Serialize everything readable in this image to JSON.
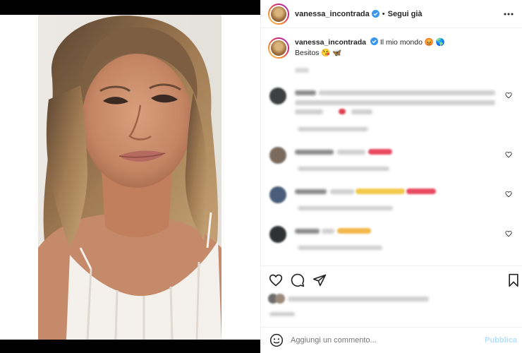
{
  "header": {
    "username": "vanessa_incontrada",
    "separator": "•",
    "follow_label": "Segui già"
  },
  "caption": {
    "username": "vanessa_incontrada",
    "text_line1": "Il mio mondo 😡 🌎",
    "text_line2": "Besitos 😘 🦋"
  },
  "comment_box": {
    "placeholder": "Aggiungi un commento...",
    "publish_label": "Pubblica"
  },
  "icons": {
    "more": "more-options-icon",
    "verified": "verified-badge-icon",
    "like": "heart-icon",
    "comment": "comment-bubble-icon",
    "share": "paper-plane-icon",
    "save": "bookmark-icon",
    "emoji": "smiley-icon"
  },
  "colors": {
    "verified_blue": "#3897f0",
    "publish_disabled": "#b2dffc",
    "heart_red": "#ed4956"
  }
}
